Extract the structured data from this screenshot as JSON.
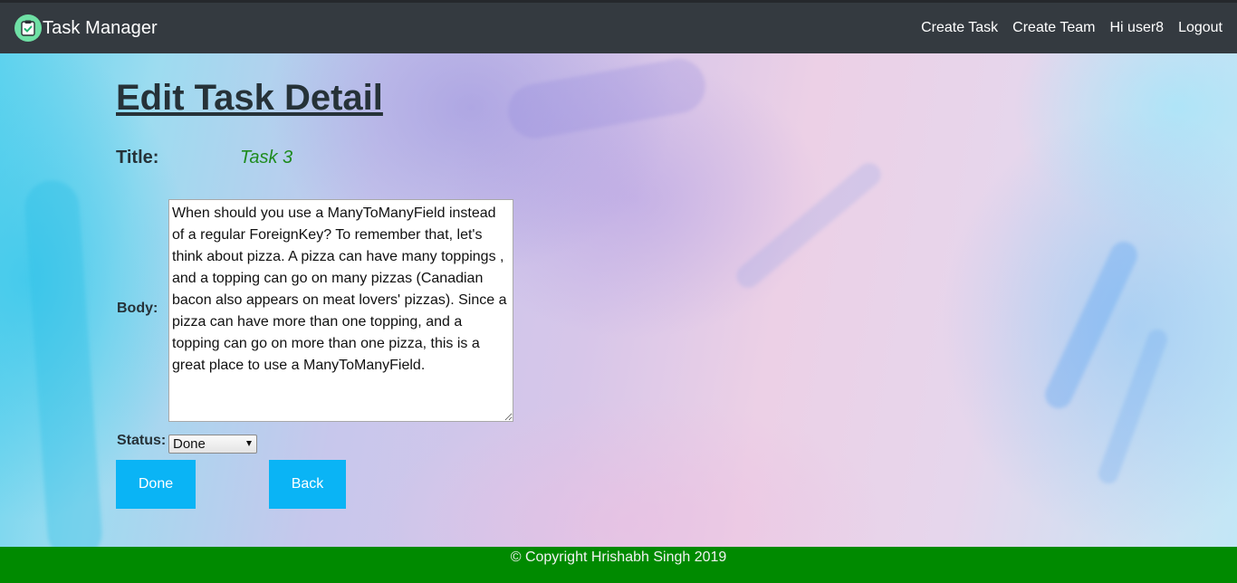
{
  "navbar": {
    "brand": "Task Manager",
    "logo_icon": "clipboard-check-icon",
    "links": {
      "create_task": "Create Task",
      "create_team": "Create Team",
      "greeting": "Hi user8",
      "logout": "Logout"
    }
  },
  "page": {
    "heading": "Edit Task Detail"
  },
  "form": {
    "title_label": "Title:",
    "title_value": "Task 3",
    "body_label": "Body:",
    "body_value": "When should you use a ManyToManyField instead of a regular ForeignKey? To remember that, let's think about pizza. A pizza can have many toppings , and a topping can go on many pizzas (Canadian bacon also appears on meat lovers' pizzas). Since a pizza can have more than one topping, and a topping can go on more than one pizza, this is a great place to use a ManyToManyField.",
    "status_label": "Status:",
    "status_selected": "Done",
    "done_button": "Done",
    "back_button": "Back"
  },
  "footer": {
    "copyright": "© Copyright Hrishabh Singh 2019"
  },
  "colors": {
    "navbar_bg": "#343a40",
    "button_bg": "#0ab4f5",
    "footer_bg": "#008a00",
    "title_value": "#1e8b1e"
  }
}
